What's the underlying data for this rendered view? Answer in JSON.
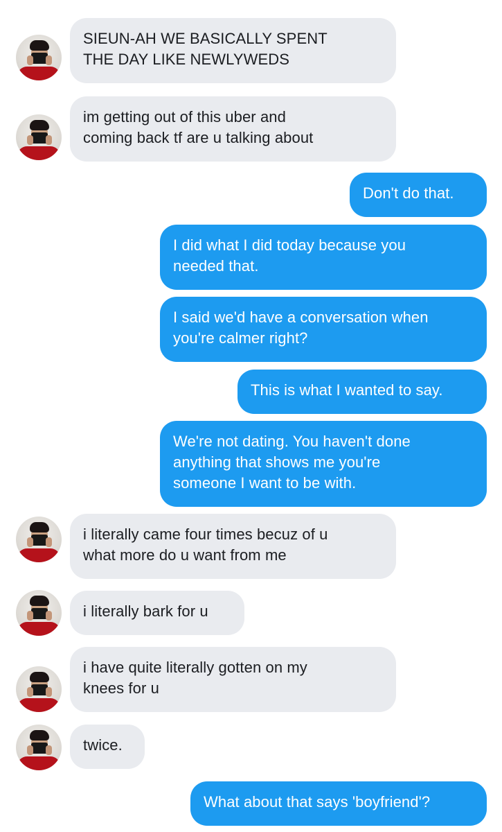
{
  "messages": [
    {
      "id": 1,
      "direction": "in",
      "text": "SIEUN-AH WE BASICALLY SPENT\nTHE DAY LIKE NEWLYWEDS"
    },
    {
      "id": 2,
      "direction": "in",
      "text": "im getting out of this uber and\ncoming back tf are u talking about"
    },
    {
      "id": 3,
      "direction": "out",
      "text": "Don't do that."
    },
    {
      "id": 4,
      "direction": "out",
      "text": "I did what I did today because you\nneeded that."
    },
    {
      "id": 5,
      "direction": "out",
      "text": "I said we'd have a conversation when\nyou're calmer right?"
    },
    {
      "id": 6,
      "direction": "out",
      "text": "This is what I wanted to say."
    },
    {
      "id": 7,
      "direction": "out",
      "text": "We're not dating. You haven't done\nanything that shows me you're\nsomeone I want to be with."
    },
    {
      "id": 8,
      "direction": "in",
      "text": "i literally came four times becuz of u\nwhat more do u want from me"
    },
    {
      "id": 9,
      "direction": "in",
      "text": "i literally bark for u"
    },
    {
      "id": 10,
      "direction": "in",
      "text": "i have quite literally gotten on my\nknees for u"
    },
    {
      "id": 11,
      "direction": "in",
      "text": "twice."
    },
    {
      "id": 12,
      "direction": "out",
      "text": "What about that says 'boyfriend'?"
    }
  ],
  "colors": {
    "incoming_bubble": "#e9ebef",
    "outgoing_bubble": "#1d9bf0",
    "outgoing_text": "#ffffff",
    "incoming_text": "#1b1d21",
    "avatar_shirt": "#b5121b"
  },
  "icons": {
    "sender_avatar": "avatar-photo-red-shirt-phone"
  }
}
